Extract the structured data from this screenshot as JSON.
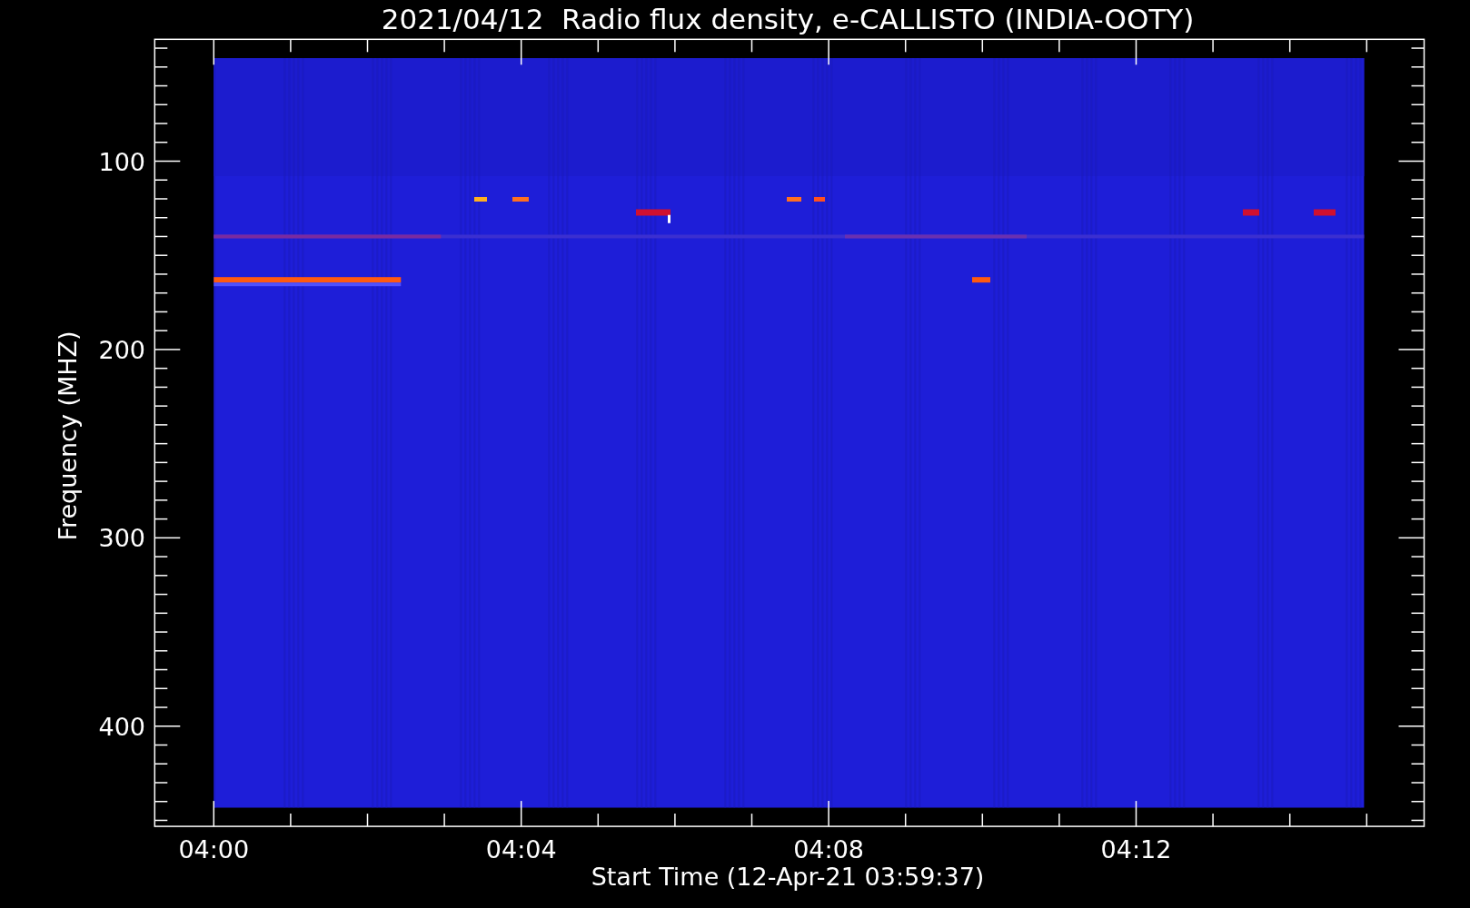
{
  "plot": {
    "title": "2021/04/12  Radio flux density, e-CALLISTO (INDIA-OOTY)",
    "x_axis": {
      "label": "Start Time (12-Apr-21 03:59:37)",
      "ticks": [
        {
          "label": "04:00"
        },
        {
          "label": "04:04"
        },
        {
          "label": "04:08"
        },
        {
          "label": "04:12"
        }
      ]
    },
    "y_axis": {
      "label": "Frequency (MHZ)",
      "ticks": [
        {
          "label": "100"
        },
        {
          "label": "200"
        },
        {
          "label": "300"
        },
        {
          "label": "400"
        }
      ]
    }
  }
}
